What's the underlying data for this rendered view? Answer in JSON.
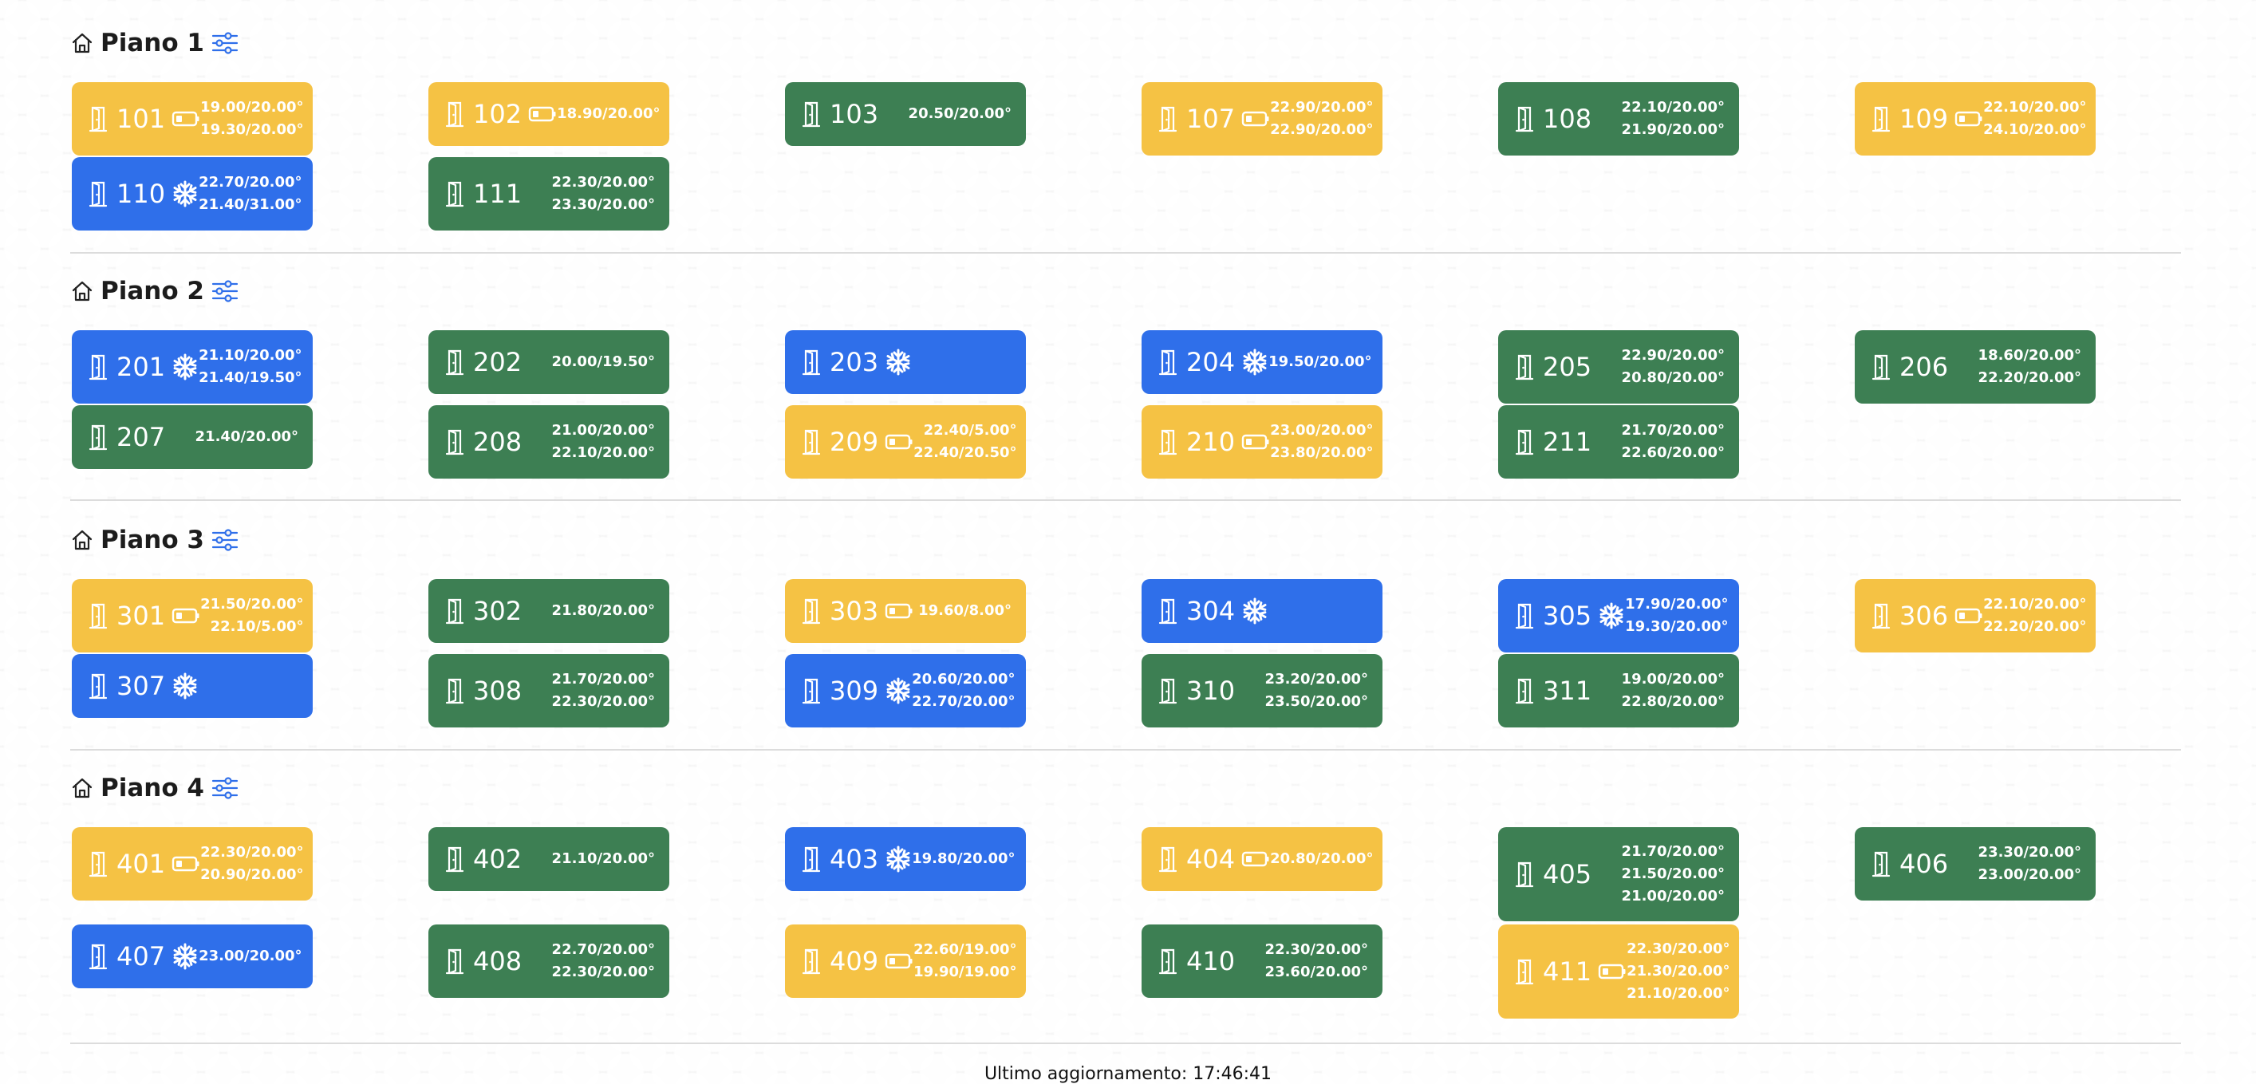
{
  "colors": {
    "yellow": "#f5c244",
    "green": "#3d7f53",
    "blue": "#2f6fea"
  },
  "floors": [
    {
      "title": "Piano 1",
      "rooms": [
        {
          "num": "101",
          "color": "yellow",
          "status": "battery-icon",
          "temps": [
            "19.00/20.00°",
            "19.30/20.00°"
          ]
        },
        {
          "num": "102",
          "color": "yellow",
          "status": "battery-icon",
          "temps": [
            "18.90/20.00°"
          ]
        },
        {
          "num": "103",
          "color": "green",
          "status": "",
          "temps": [
            "20.50/20.00°"
          ]
        },
        {
          "num": "107",
          "color": "yellow",
          "status": "battery-icon",
          "temps": [
            "22.90/20.00°",
            "22.90/20.00°"
          ]
        },
        {
          "num": "108",
          "color": "green",
          "status": "",
          "temps": [
            "22.10/20.00°",
            "21.90/20.00°"
          ]
        },
        {
          "num": "109",
          "color": "yellow",
          "status": "battery-icon",
          "temps": [
            "22.10/20.00°",
            "24.10/20.00°"
          ]
        },
        {
          "num": "110",
          "color": "blue",
          "status": "snowflake-icon",
          "temps": [
            "22.70/20.00°",
            "21.40/31.00°"
          ]
        },
        {
          "num": "111",
          "color": "green",
          "status": "",
          "temps": [
            "22.30/20.00°",
            "23.30/20.00°"
          ]
        }
      ]
    },
    {
      "title": "Piano 2",
      "rooms": [
        {
          "num": "201",
          "color": "blue",
          "status": "snowflake-icon",
          "temps": [
            "21.10/20.00°",
            "21.40/19.50°"
          ]
        },
        {
          "num": "202",
          "color": "green",
          "status": "",
          "temps": [
            "20.00/19.50°"
          ]
        },
        {
          "num": "203",
          "color": "blue",
          "status": "snowflake-icon",
          "temps": []
        },
        {
          "num": "204",
          "color": "blue",
          "status": "snowflake-icon",
          "temps": [
            "19.50/20.00°"
          ]
        },
        {
          "num": "205",
          "color": "green",
          "status": "",
          "temps": [
            "22.90/20.00°",
            "20.80/20.00°"
          ]
        },
        {
          "num": "206",
          "color": "green",
          "status": "",
          "temps": [
            "18.60/20.00°",
            "22.20/20.00°"
          ]
        },
        {
          "num": "207",
          "color": "green",
          "status": "",
          "temps": [
            "21.40/20.00°"
          ]
        },
        {
          "num": "208",
          "color": "green",
          "status": "",
          "temps": [
            "21.00/20.00°",
            "22.10/20.00°"
          ]
        },
        {
          "num": "209",
          "color": "yellow",
          "status": "battery-icon",
          "temps": [
            "22.40/5.00°",
            "22.40/20.50°"
          ]
        },
        {
          "num": "210",
          "color": "yellow",
          "status": "battery-icon",
          "temps": [
            "23.00/20.00°",
            "23.80/20.00°"
          ]
        },
        {
          "num": "211",
          "color": "green",
          "status": "",
          "temps": [
            "21.70/20.00°",
            "22.60/20.00°"
          ]
        }
      ]
    },
    {
      "title": "Piano 3",
      "rooms": [
        {
          "num": "301",
          "color": "yellow",
          "status": "battery-icon",
          "temps": [
            "21.50/20.00°",
            "22.10/5.00°"
          ]
        },
        {
          "num": "302",
          "color": "green",
          "status": "",
          "temps": [
            "21.80/20.00°"
          ]
        },
        {
          "num": "303",
          "color": "yellow",
          "status": "battery-icon",
          "temps": [
            "19.60/8.00°"
          ]
        },
        {
          "num": "304",
          "color": "blue",
          "status": "snowflake-icon",
          "temps": []
        },
        {
          "num": "305",
          "color": "blue",
          "status": "snowflake-icon",
          "temps": [
            "17.90/20.00°",
            "19.30/20.00°"
          ]
        },
        {
          "num": "306",
          "color": "yellow",
          "status": "battery-icon",
          "temps": [
            "22.10/20.00°",
            "22.20/20.00°"
          ]
        },
        {
          "num": "307",
          "color": "blue",
          "status": "snowflake-icon",
          "temps": []
        },
        {
          "num": "308",
          "color": "green",
          "status": "",
          "temps": [
            "21.70/20.00°",
            "22.30/20.00°"
          ]
        },
        {
          "num": "309",
          "color": "blue",
          "status": "snowflake-icon",
          "temps": [
            "20.60/20.00°",
            "22.70/20.00°"
          ]
        },
        {
          "num": "310",
          "color": "green",
          "status": "",
          "temps": [
            "23.20/20.00°",
            "23.50/20.00°"
          ]
        },
        {
          "num": "311",
          "color": "green",
          "status": "",
          "temps": [
            "19.00/20.00°",
            "22.80/20.00°"
          ]
        }
      ]
    },
    {
      "title": "Piano 4",
      "rooms": [
        {
          "num": "401",
          "color": "yellow",
          "status": "battery-icon",
          "temps": [
            "22.30/20.00°",
            "20.90/20.00°"
          ]
        },
        {
          "num": "402",
          "color": "green",
          "status": "",
          "temps": [
            "21.10/20.00°"
          ]
        },
        {
          "num": "403",
          "color": "blue",
          "status": "snowflake-icon",
          "temps": [
            "19.80/20.00°"
          ]
        },
        {
          "num": "404",
          "color": "yellow",
          "status": "battery-icon",
          "temps": [
            "20.80/20.00°"
          ]
        },
        {
          "num": "405",
          "color": "green",
          "status": "",
          "temps": [
            "21.70/20.00°",
            "21.50/20.00°",
            "21.00/20.00°"
          ]
        },
        {
          "num": "406",
          "color": "green",
          "status": "",
          "temps": [
            "23.30/20.00°",
            "23.00/20.00°"
          ]
        },
        {
          "num": "407",
          "color": "blue",
          "status": "snowflake-icon",
          "temps": [
            "23.00/20.00°"
          ]
        },
        {
          "num": "408",
          "color": "green",
          "status": "",
          "temps": [
            "22.70/20.00°",
            "22.30/20.00°"
          ]
        },
        {
          "num": "409",
          "color": "yellow",
          "status": "battery-icon",
          "temps": [
            "22.60/19.00°",
            "19.90/19.00°"
          ]
        },
        {
          "num": "410",
          "color": "green",
          "status": "",
          "temps": [
            "22.30/20.00°",
            "23.60/20.00°"
          ]
        },
        {
          "num": "411",
          "color": "yellow",
          "status": "battery-icon",
          "temps": [
            "22.30/20.00°",
            "21.30/20.00°",
            "21.10/20.00°"
          ]
        }
      ]
    }
  ],
  "footer": {
    "last_update": "Ultimo aggiornamento: 17:46:41"
  }
}
